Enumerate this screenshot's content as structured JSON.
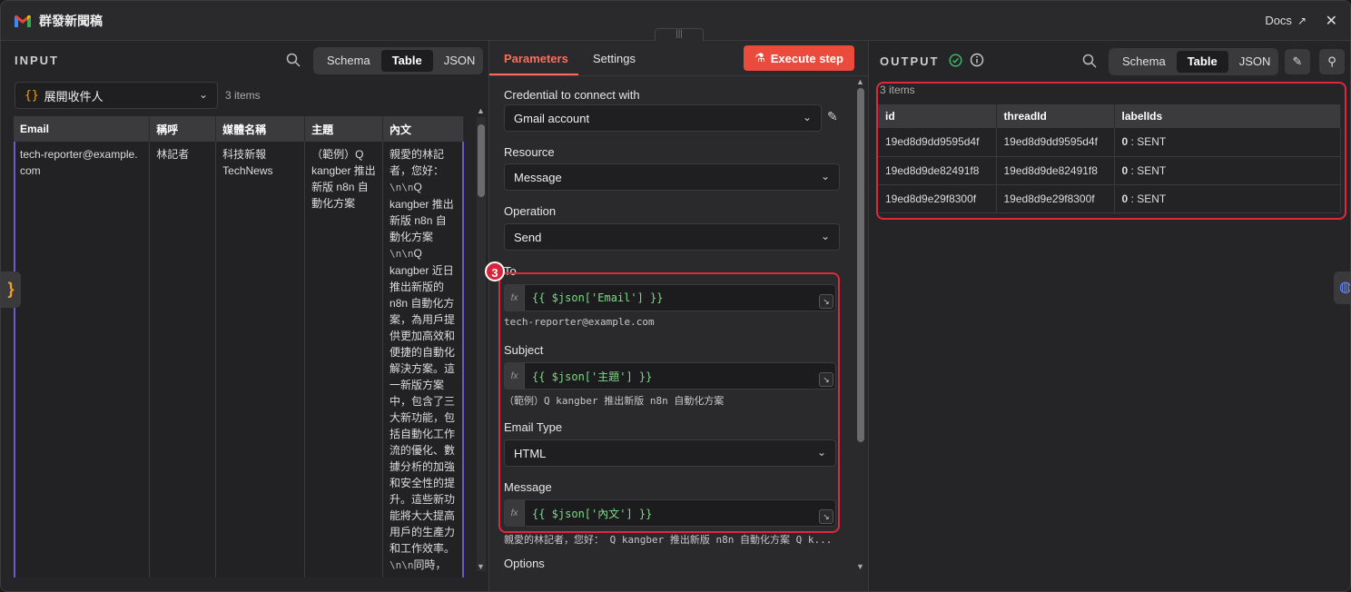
{
  "window": {
    "title": "群發新聞稿",
    "docs_label": "Docs",
    "drag_glyph": "|||",
    "close_glyph": "✕"
  },
  "input": {
    "label": "INPUT",
    "view_tabs": [
      "Schema",
      "Table",
      "JSON"
    ],
    "active_tab": "Table",
    "node_select": "展開收件人",
    "items_count": "3 items",
    "columns": [
      "Email",
      "稱呼",
      "媒體名稱",
      "主題",
      "內文"
    ],
    "row": {
      "email": "tech-reporter@example.com",
      "salutation": "林記者",
      "media": "科技新報 TechNews",
      "subject": "（範例）Q kangber 推出新版 n8n 自動化方案",
      "body_segments": [
        {
          "t": "text",
          "v": "親愛的林記者，您好："
        },
        {
          "t": "mono",
          "v": "\\n\\n"
        },
        {
          "t": "text",
          "v": "Q kangber 推出新版 n8n 自動化方案"
        },
        {
          "t": "mono",
          "v": "\\n\\n"
        },
        {
          "t": "text",
          "v": "Q kangber 近日推出新版的 n8n 自動化方案，為用戶提供更加高效和便捷的自動化解決方案。這一新版方案中，包含了三大新功能，包括自動化工作流的優化、數據分析的加強和安全性的提升。這些新功能將大大提高用戶的生產力和工作效率。"
        },
        {
          "t": "mono",
          "v": "\\n\\n"
        },
        {
          "t": "text",
          "v": "同時，"
        }
      ]
    },
    "side_tab_glyph": "}"
  },
  "params": {
    "tabs": [
      "Parameters",
      "Settings"
    ],
    "active_tab": "Parameters",
    "execute_label": "Execute step",
    "credential_label": "Credential to connect with",
    "credential_value": "Gmail account",
    "resource_label": "Resource",
    "resource_value": "Message",
    "operation_label": "Operation",
    "operation_value": "Send",
    "to_label": "To",
    "to_expr": "{{ $json['Email'] }}",
    "to_preview": "tech-reporter@example.com",
    "subject_label": "Subject",
    "subject_expr": "{{ $json['主題'] }}",
    "subject_preview": "（範例）Q kangber 推出新版 n8n 自動化方案",
    "email_type_label": "Email Type",
    "email_type_value": "HTML",
    "message_label": "Message",
    "message_expr": "{{ $json['內文'] }}",
    "message_preview": "親愛的林記者，您好： Q kangber 推出新版 n8n 自動化方案 Q k...",
    "options_label": "Options",
    "badge_number": "3",
    "fx_label": "fx"
  },
  "output": {
    "label": "OUTPUT",
    "view_tabs": [
      "Schema",
      "Table",
      "JSON"
    ],
    "active_tab": "Table",
    "items_count": "3 items",
    "columns": [
      "id",
      "threadId",
      "labelIds"
    ],
    "rows": [
      {
        "id": "19ed8d9dd9595d4f",
        "threadId": "19ed8d9dd9595d4f",
        "label_index": "0",
        "label_value": ": SENT"
      },
      {
        "id": "19ed8d9de82491f8",
        "threadId": "19ed8d9de82491f8",
        "label_index": "0",
        "label_value": ": SENT"
      },
      {
        "id": "19ed8d9e29f8300f",
        "threadId": "19ed8d9e29f8300f",
        "label_index": "0",
        "label_value": ": SENT"
      }
    ]
  },
  "colors": {
    "accent": "#ea4b3c",
    "highlight_box": "#e0283c",
    "expression_text": "#7fd88a",
    "success": "#3fbf6f"
  }
}
